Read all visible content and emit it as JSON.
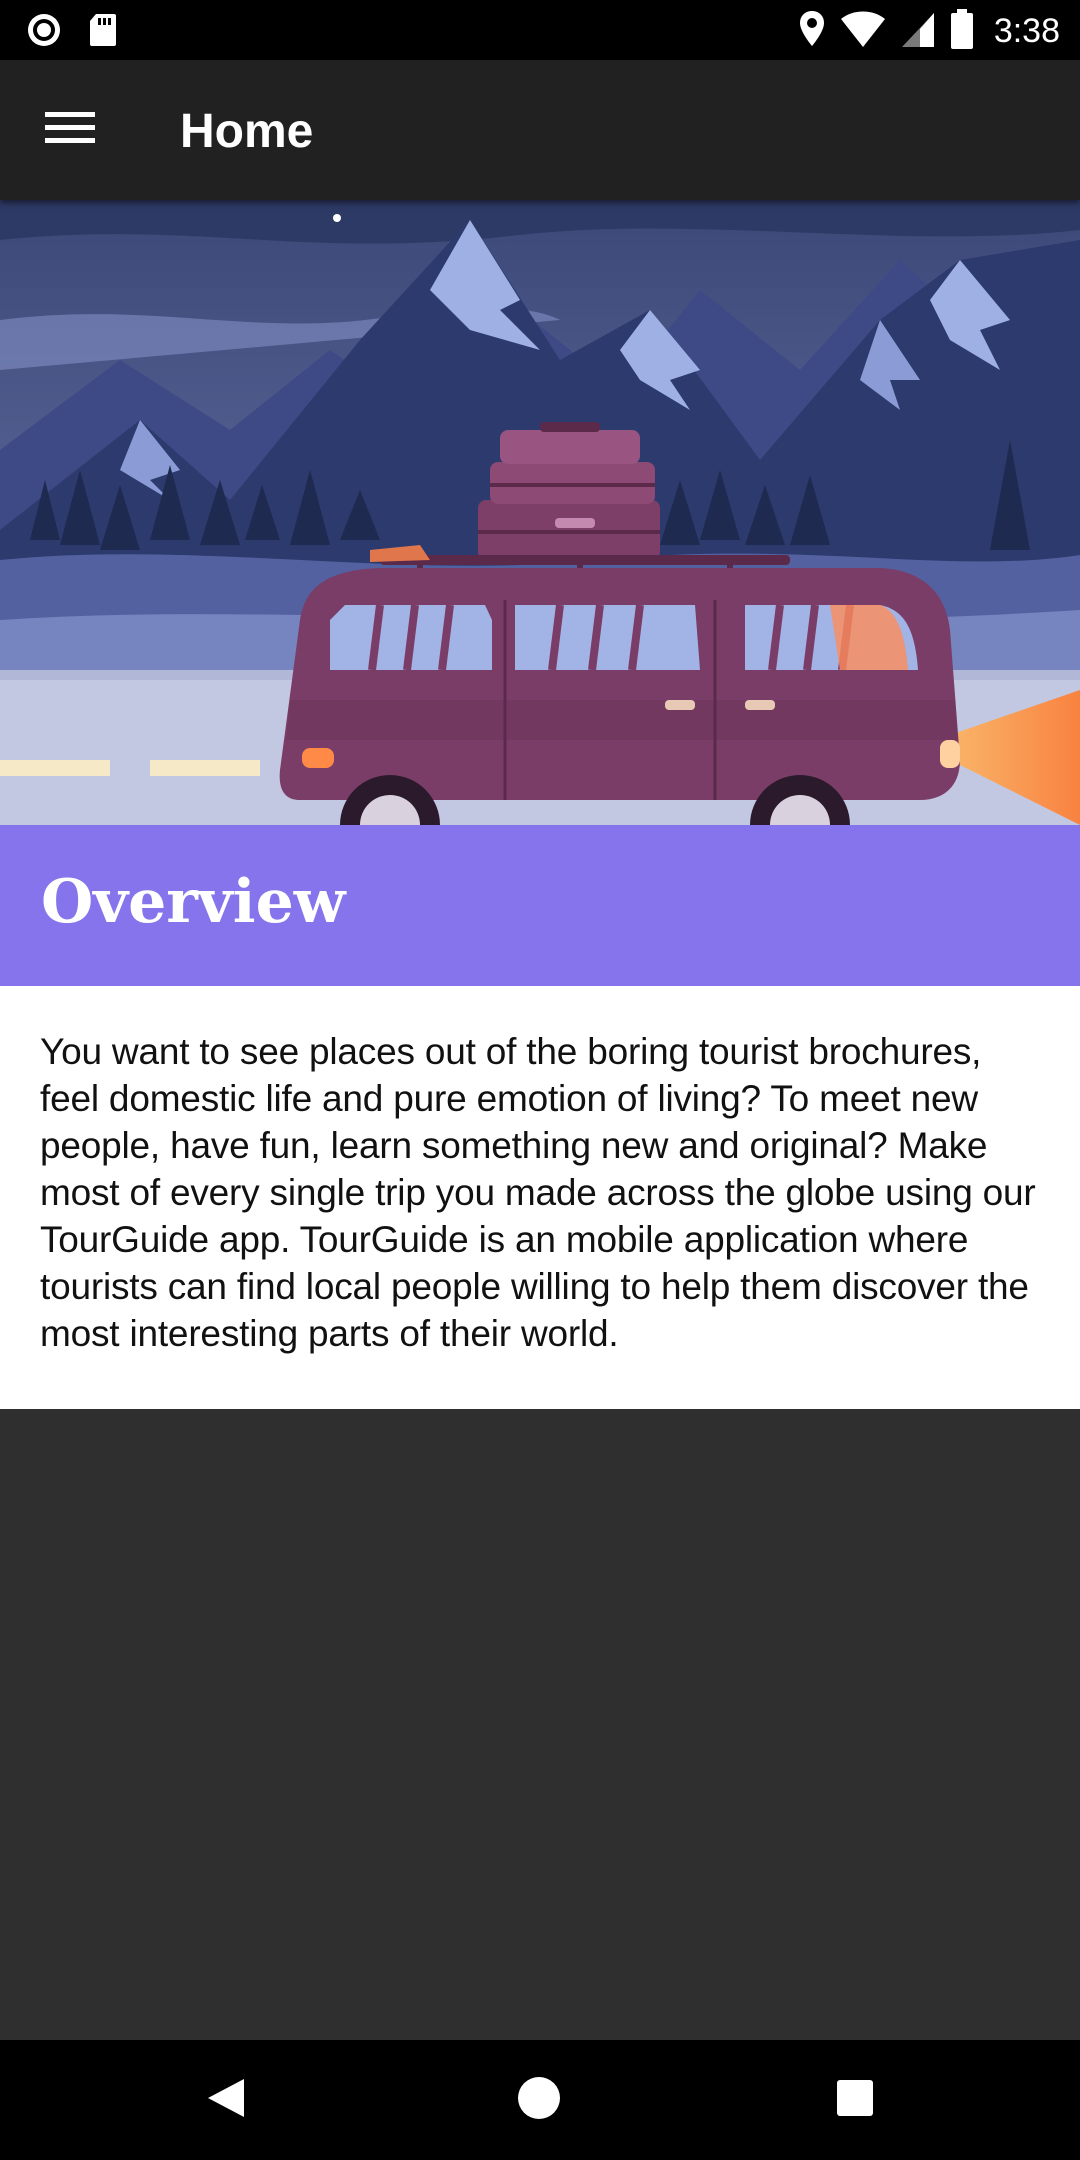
{
  "status_bar": {
    "time": "3:38",
    "left_icons": [
      "record-icon",
      "sd-card-icon"
    ],
    "right_icons": [
      "location-icon",
      "wifi-icon",
      "signal-icon",
      "battery-icon"
    ]
  },
  "app_bar": {
    "title": "Home",
    "menu_icon": "hamburger-menu-icon"
  },
  "hero": {
    "image": "van-mountains-illustration"
  },
  "overview": {
    "title": "Overview",
    "description": "You want to see places out of the boring tourist brochures, feel domestic life and pure emotion of living? To meet new people, have fun, learn something new and original? Make most of every single trip you made across the globe using our TourGuide app. TourGuide is an mobile application where tourists can find local people willing to help them discover the most interesting parts of their world."
  },
  "nav_bar": {
    "buttons": [
      "back-icon",
      "home-icon",
      "recents-icon"
    ]
  },
  "colors": {
    "status_bar": "#000000",
    "app_bar": "#212121",
    "accent": "#8574ec",
    "background": "#2f2f2f",
    "card": "#ffffff"
  }
}
